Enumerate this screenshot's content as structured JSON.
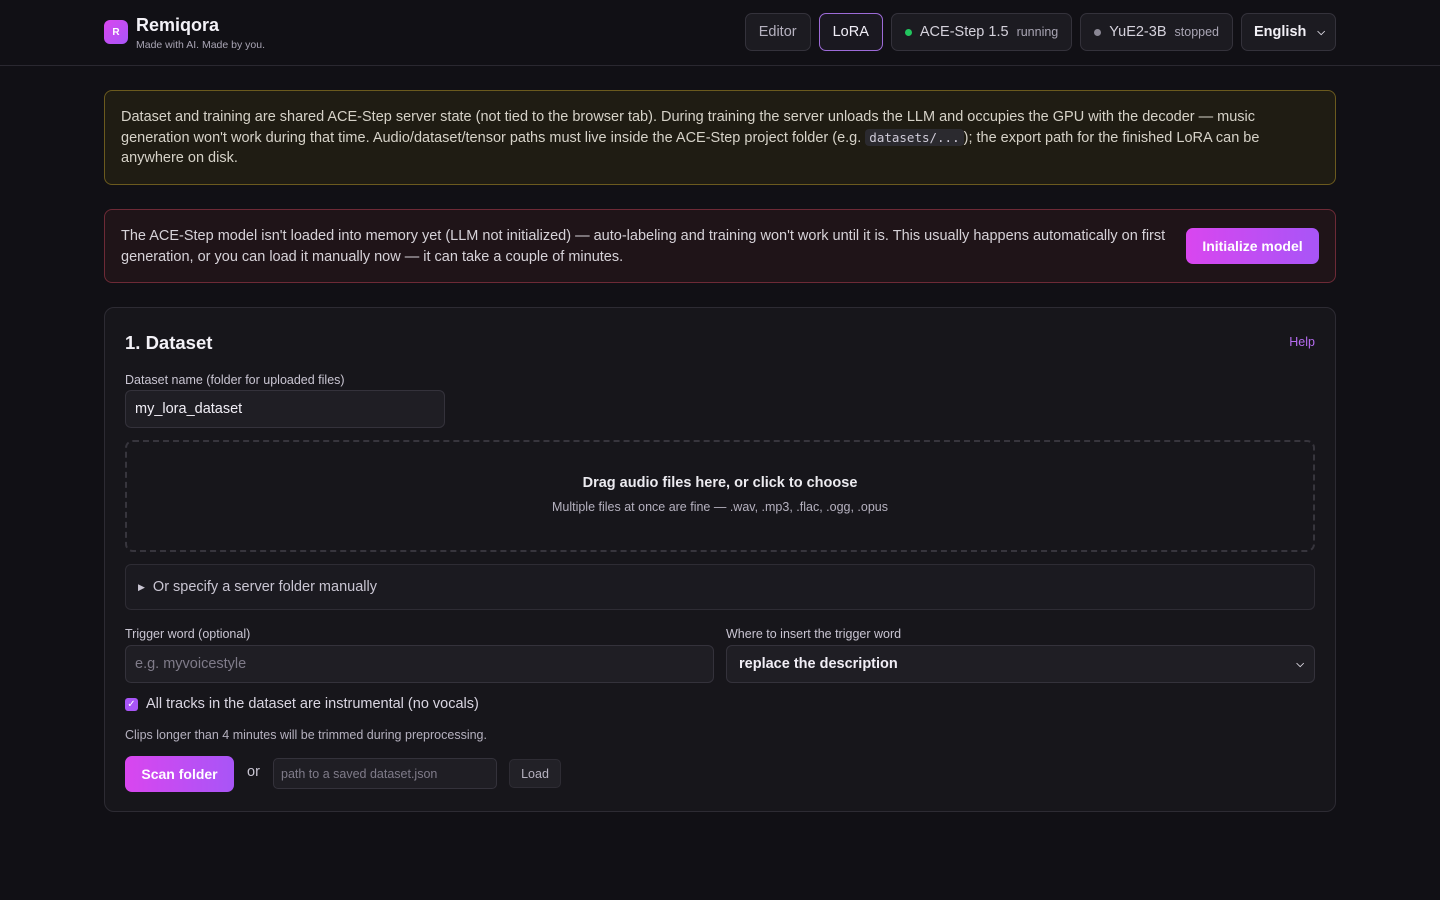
{
  "header": {
    "logo_letter": "R",
    "app_name": "Remiqora",
    "tagline": "Made with AI. Made by you.",
    "nav": {
      "editor": "Editor",
      "lora": "LoRA"
    },
    "services": [
      {
        "name": "ACE-Step 1.5",
        "state": "running",
        "dot_color": "#22c55e"
      },
      {
        "name": "YuE2-3B",
        "state": "stopped",
        "dot_color": "#8a8794"
      }
    ],
    "language": "English"
  },
  "banners": {
    "warning_pre": "Dataset and training are shared ACE-Step server state (not tied to the browser tab). During training the server unloads the LLM and occupies the GPU with the decoder — music generation won't work during that time. Audio/dataset/tensor paths must live inside the ACE-Step project folder (e.g. ",
    "warning_code": "datasets/...",
    "warning_post": "); the export path for the finished LoRA can be anywhere on disk.",
    "error_text": "The ACE-Step model isn't loaded into memory yet (LLM not initialized) — auto-labeling and training won't work until it is. This usually happens automatically on first generation, or you can load it manually now — it can take a couple of minutes.",
    "init_button": "Initialize model"
  },
  "dataset": {
    "title": "1. Dataset",
    "help": "Help",
    "name_label": "Dataset name (folder for uploaded files)",
    "name_value": "my_lora_dataset",
    "drop_title": "Drag audio files here, or click to choose",
    "drop_subtitle": "Multiple files at once are fine — .wav, .mp3, .flac, .ogg, .opus",
    "server_folder": "Or specify a server folder manually",
    "trigger_label": "Trigger word (optional)",
    "trigger_placeholder": "e.g. myvoicestyle",
    "insert_label": "Where to insert the trigger word",
    "insert_value": "replace the description",
    "instrumental_label": "All tracks in the dataset are instrumental (no vocals)",
    "instrumental_checked": true,
    "trim_note": "Clips longer than 4 minutes will be trimmed during preprocessing.",
    "scan_button": "Scan folder",
    "or_text": "or",
    "json_placeholder": "path to a saved dataset.json",
    "load_button": "Load"
  },
  "colors": {
    "accent_start": "#d946ef",
    "accent_end": "#a855f7",
    "background": "#111015"
  }
}
